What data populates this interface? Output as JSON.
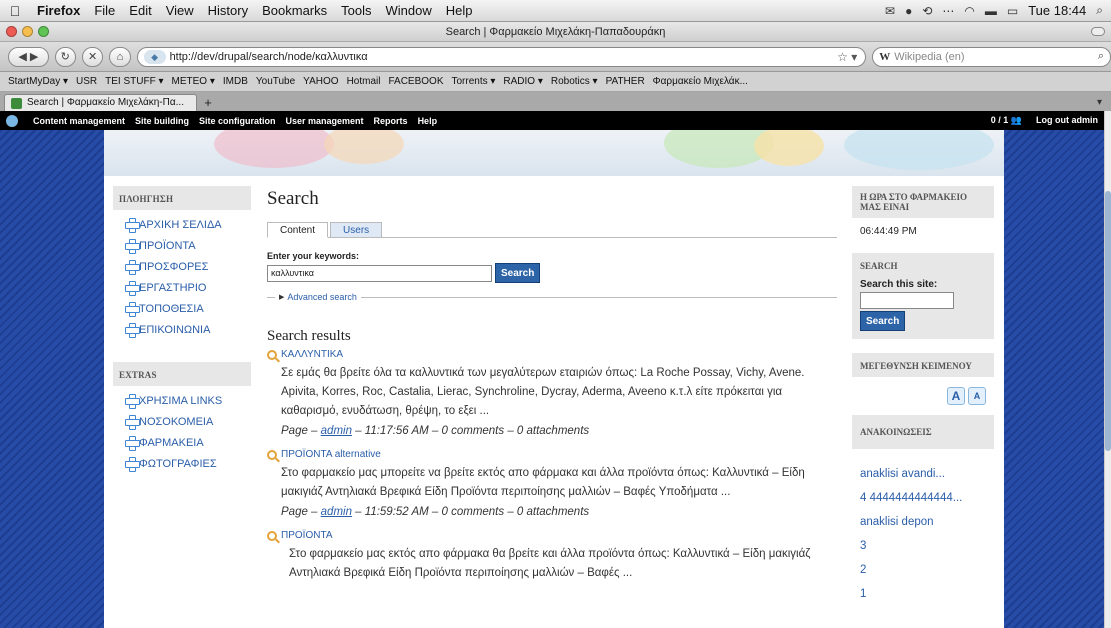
{
  "mac_menu": {
    "apple": "",
    "items": [
      "Firefox",
      "File",
      "Edit",
      "View",
      "History",
      "Bookmarks",
      "Tools",
      "Window",
      "Help"
    ],
    "clock": "Tue 18:44"
  },
  "window": {
    "title": "Search | Φαρμακείο Μιχελάκη-Παπαδουράκη"
  },
  "nav": {
    "url": "http://dev/drupal/search/node/καλλυντικα",
    "search_placeholder": "Wikipedia (en)",
    "search_engine": "W"
  },
  "bookmarks": [
    "StartMyDay ▾",
    "USR",
    "TEI STUFF ▾",
    "METEO ▾",
    "IMDB",
    "YouTube",
    "YAHOO",
    "Hotmail",
    "FACEBOOK",
    "Torrents ▾",
    "RADIO ▾",
    "Robotics ▾",
    "PATHER",
    "Φαρμακείο Μιχελάκ..."
  ],
  "tab": {
    "title": "Search | Φαρμακείο Μιχελάκη-Πα..."
  },
  "admin": {
    "items": [
      "Content management",
      "Site building",
      "Site configuration",
      "User management",
      "Reports",
      "Help"
    ],
    "users": "0 / 1",
    "logout": "Log out admin"
  },
  "left_sidebar": {
    "nav_title": "ΠΛΟΗΓΗΣΗ",
    "nav_items": [
      "ΑΡΧΙΚΗ ΣΕΛΙΔΑ",
      "ΠΡΟΪΟΝΤΑ",
      "ΠΡΟΣΦΟΡΕΣ",
      "ΕΡΓΑΣΤΗΡΙΟ",
      "ΤΟΠΟΘΕΣΙΑ",
      "ΕΠΙΚΟΙΝΩΝΙΑ"
    ],
    "extras_title": "EXTRAS",
    "extras_items": [
      "ΧΡΗΣΙΜΑ LINKS",
      "ΝΟΣΟΚΟΜΕΙΑ",
      "ΦΑΡΜΑΚΕΙΑ",
      "ΦΩΤΟΓΡΑΦΙΕΣ"
    ]
  },
  "main": {
    "title": "Search",
    "tabs": [
      "Content",
      "Users"
    ],
    "keywords_label": "Enter your keywords:",
    "keywords_value": "καλλυντικα",
    "search_button": "Search",
    "advanced": "Advanced search",
    "results_title": "Search results",
    "results": [
      {
        "title": "ΚΑΛΛΥΝΤΙΚΑ",
        "snippet": "Σε εμάς θα βρείτε όλα τα καλλυντικά των μεγαλύτερων εταιριών όπως: La Roche Possay, Vichy, Avene. Apivita, Korres, Roc, Castalia, Lierac, Synchroline, Dycray, Aderma, Aveeno κ.τ.λ είτε πρόκειται για καθαρισμό, ενυδάτωση, θρέψη, το εξει ...",
        "type": "Page",
        "author": "admin",
        "rest": "11:17:56 AM – 0 comments – 0 attachments"
      },
      {
        "title": "ΠΡΟΪΟΝΤΑ alternative",
        "snippet": "Στο φαρμακείο μας μπορείτε να βρείτε εκτός απο φάρμακα και άλλα προϊόντα όπως: Καλλυντικά – Είδη μακιγιάζ Αντηλιακά Βρεφικά Είδη Προϊόντα περιποίησης μαλλιών – Βαφές Υποδήματα ...",
        "type": "Page",
        "author": "admin",
        "rest": "11:59:52 AM – 0 comments – 0 attachments"
      },
      {
        "title": "ΠΡΟΪΟΝΤΑ",
        "snippet": "Στο φαρμακείο μας εκτός απο φάρμακα θα βρείτε και άλλα προϊόντα όπως:  Καλλυντικά – Είδη μακιγιάζ Αντηλιακά Βρεφικά Είδη Προϊόντα περιποίησης μαλλιών – Βαφές ..."
      }
    ]
  },
  "right_sidebar": {
    "clock_title": "Η ΩΡΑ ΣΤΟ ΦΑΡΜΑΚΕΙΟ ΜΑΣ ΕΙΝΑΙ",
    "clock_value": "06:44:49 PM",
    "search_title": "SEARCH",
    "search_label": "Search this site:",
    "search_button": "Search",
    "fontsize_title": "ΜΕΓΕΘΥΝΣΗ ΚΕΙΜΕΝΟΥ",
    "font_big": "A",
    "font_small": "A",
    "announcements_title": "ΑΝΑΚΟΙΝΩΣΕΙΣ",
    "announcements": [
      "anaklisi avandi...",
      "4 4444444444444...",
      "anaklisi depon",
      "3",
      "2",
      "1"
    ]
  }
}
